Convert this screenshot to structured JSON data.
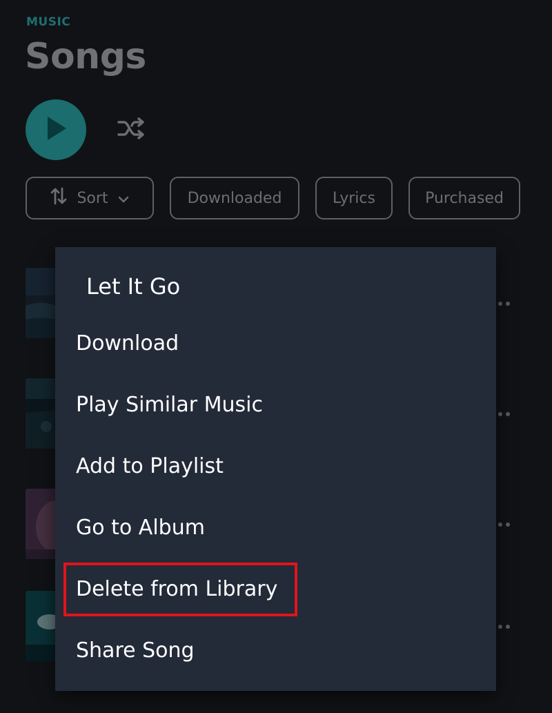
{
  "header": {
    "section_label": "MUSIC",
    "title": "Songs"
  },
  "controls": {
    "play_icon": "play-icon",
    "shuffle_icon": "shuffle-icon"
  },
  "filters": {
    "sort_label": "Sort",
    "downloaded_label": "Downloaded",
    "lyrics_label": "Lyrics",
    "purchased_label": "Purchased"
  },
  "context_menu": {
    "song_title": "Let It Go",
    "items": [
      "Download",
      "Play Similar Music",
      "Add to Playlist",
      "Go to Album",
      "Delete from Library",
      "Share Song"
    ],
    "highlighted_item": "Delete from Library"
  },
  "colors": {
    "background": "#101215",
    "accent": "#1b6d6e",
    "menu_background": "#232a38",
    "highlight": "#e0141c"
  }
}
